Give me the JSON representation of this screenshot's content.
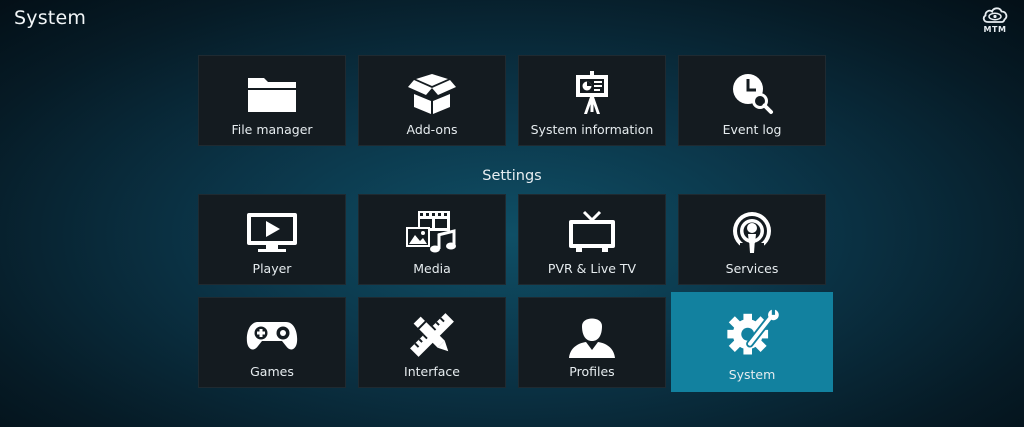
{
  "header": {
    "title": "System",
    "logo_text": "MTM"
  },
  "top_row": [
    {
      "label": "File manager",
      "icon": "folder-icon"
    },
    {
      "label": "Add-ons",
      "icon": "open-box-icon"
    },
    {
      "label": "System information",
      "icon": "presentation-easel-icon"
    },
    {
      "label": "Event log",
      "icon": "clock-search-icon"
    }
  ],
  "settings": {
    "heading": "Settings",
    "items": [
      {
        "label": "Player",
        "icon": "play-monitor-icon"
      },
      {
        "label": "Media",
        "icon": "media-film-music-icon"
      },
      {
        "label": "PVR & Live TV",
        "icon": "tv-antenna-icon"
      },
      {
        "label": "Services",
        "icon": "broadcast-icon"
      },
      {
        "label": "Games",
        "icon": "gamepad-icon"
      },
      {
        "label": "Interface",
        "icon": "pencil-ruler-icon"
      },
      {
        "label": "Profiles",
        "icon": "person-icon"
      },
      {
        "label": "System",
        "icon": "gear-wrench-icon",
        "selected": true
      }
    ]
  },
  "colors": {
    "selected_tile": "#12819f",
    "tile": "#141b20",
    "text": "#e6ecef"
  }
}
